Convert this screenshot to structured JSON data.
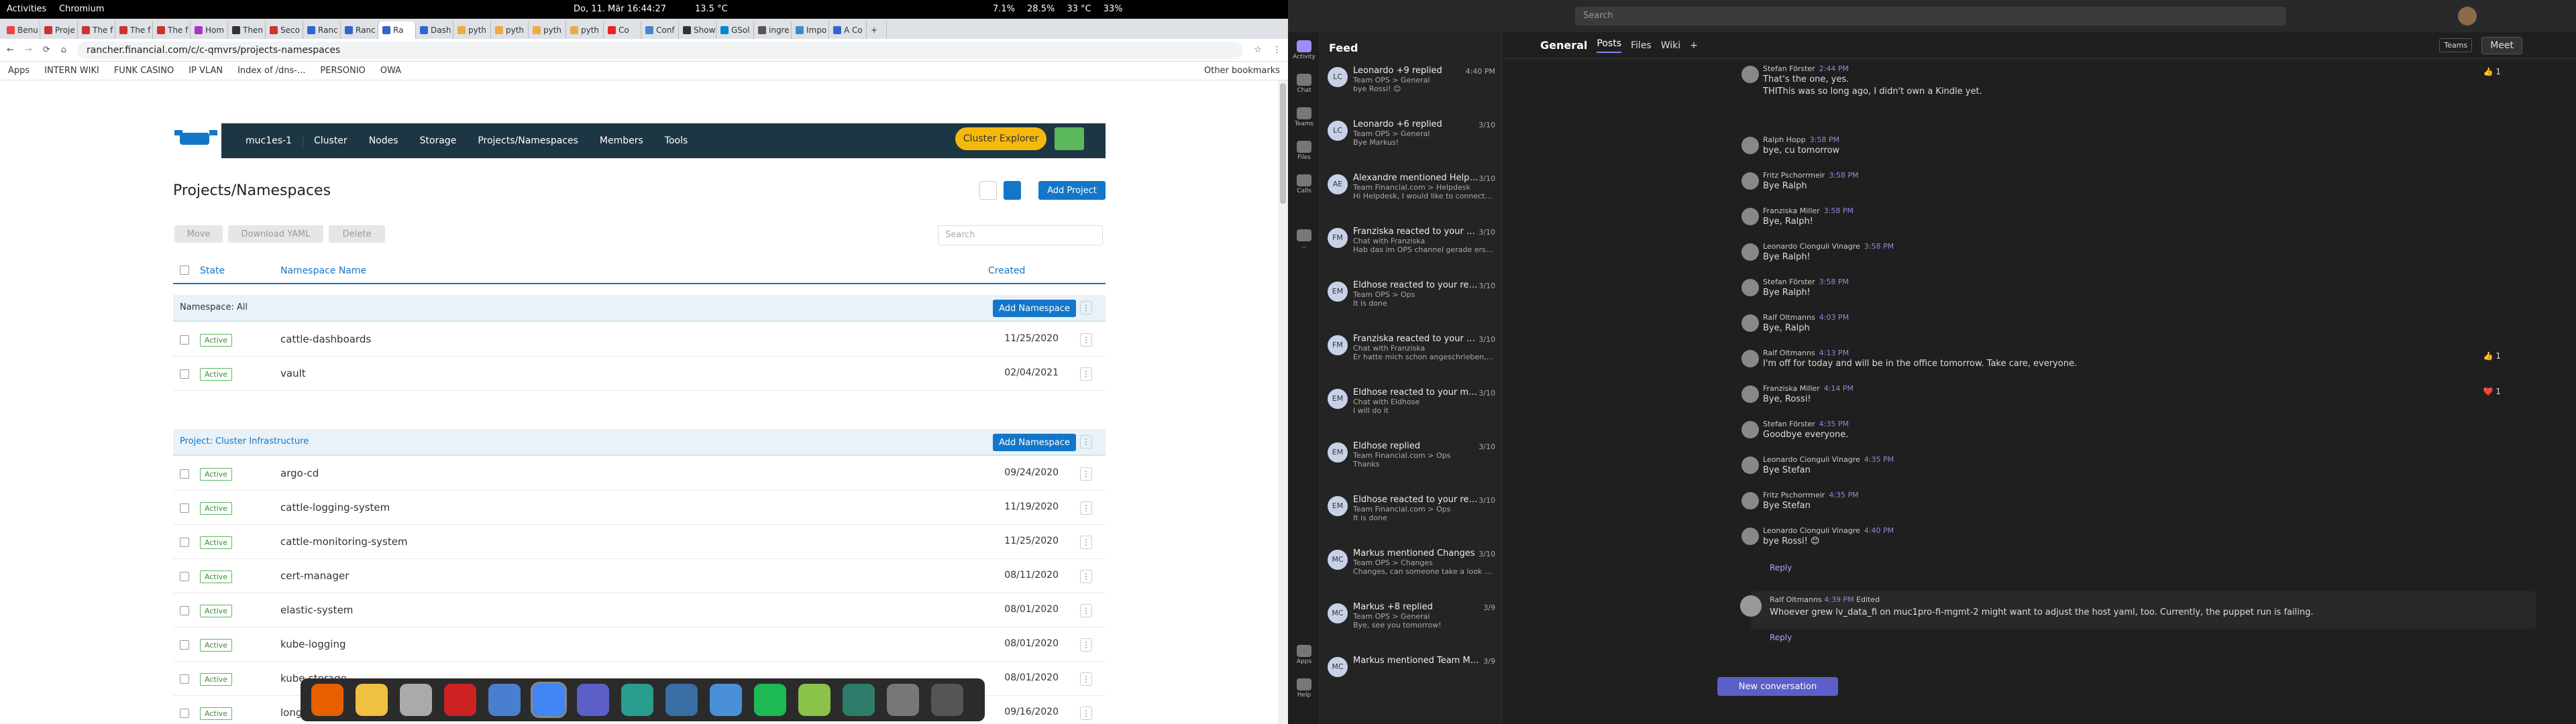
{
  "topbar": {
    "activities": "Activities",
    "app": "Chromium",
    "clock": "Do, 11. Mär 16:44:27",
    "weather": "13.5 °C",
    "cpu": "7.1%",
    "mem": "28.5%",
    "temp": "33 °C",
    "battery": "33%"
  },
  "tabs": [
    "Benu",
    "Proje",
    "The f",
    "The f",
    "The f",
    "Hom",
    "Then",
    "Seco",
    "Ranc",
    "Ranc",
    "Ra",
    "Dash",
    "pyth",
    "pyth",
    "pyth",
    "pyth",
    "Co",
    "Conf",
    "Show",
    "GSol",
    "ingre",
    "Impo",
    "A Co"
  ],
  "address": {
    "url": "rancher.financial.com/c/c-qmvrs/projects-namespaces"
  },
  "bookmarks": [
    "Apps",
    "INTERN WIKI",
    "FUNK CASINO",
    "IP VLAN",
    "Index of /dns-...",
    "PERSONIO",
    "OWA",
    "Other bookmarks"
  ],
  "rancher": {
    "nav": {
      "cluster_select": "muc1es-1",
      "items": [
        "Cluster",
        "Nodes",
        "Storage",
        "Projects/Namespaces",
        "Members",
        "Tools"
      ],
      "explorer": "Cluster Explorer"
    },
    "title": "Projects/Namespaces",
    "add_project": "Add Project",
    "actions": {
      "move": "Move",
      "download": "Download YAML",
      "delete": "Delete"
    },
    "search_placeholder": "Search",
    "headers": {
      "state": "State",
      "name": "Namespace Name",
      "created": "Created"
    },
    "add_namespace": "Add Namespace",
    "group_all": "Namespace: All",
    "group_infra": "Project: Cluster Infrastructure",
    "rows_all": [
      {
        "state": "Active",
        "name": "cattle-dashboards",
        "created": "11/25/2020"
      },
      {
        "state": "Active",
        "name": "vault",
        "created": "02/04/2021"
      }
    ],
    "rows_infra": [
      {
        "state": "Active",
        "name": "argo-cd",
        "created": "09/24/2020"
      },
      {
        "state": "Active",
        "name": "cattle-logging-system",
        "created": "11/19/2020"
      },
      {
        "state": "Active",
        "name": "cattle-monitoring-system",
        "created": "11/25/2020"
      },
      {
        "state": "Active",
        "name": "cert-manager",
        "created": "08/11/2020"
      },
      {
        "state": "Active",
        "name": "elastic-system",
        "created": "08/01/2020"
      },
      {
        "state": "Active",
        "name": "kube-logging",
        "created": "08/01/2020"
      },
      {
        "state": "Active",
        "name": "kube-storage",
        "created": "08/01/2020"
      },
      {
        "state": "Active",
        "name": "long",
        "created": "09/16/2020"
      }
    ]
  },
  "teams": {
    "search": "Search",
    "feed_title": "Feed",
    "rail": [
      "Activity",
      "Chat",
      "Teams",
      "Files",
      "Calls",
      "...",
      "Apps",
      "Help"
    ],
    "feed": [
      {
        "av": "LC",
        "title": "Leonardo +9 replied",
        "sub1": "Team OPS > General",
        "sub2": "bye Rossi! 😊",
        "time": "4:40 PM"
      },
      {
        "av": "LC",
        "title": "Leonardo +6 replied",
        "sub1": "Team OPS > General",
        "sub2": "Bye Markus!",
        "time": "3/10"
      },
      {
        "av": "AE",
        "title": "Alexandre mentioned Helpdesk",
        "sub1": "Team Financial.com > Helpdesk",
        "sub2": "Hi Helpdesk, I would like to connect the call syste...",
        "time": "3/10"
      },
      {
        "av": "FM",
        "title": "Franziska reacted to your message",
        "sub1": "Chat with Franziska",
        "sub2": "Hab das im OPS channel gerade erst gesehen, hab...",
        "time": "3/10"
      },
      {
        "av": "EM",
        "title": "Eldhose reacted to your reply",
        "sub1": "Team OPS > Ops",
        "sub2": "It is done",
        "time": "3/10"
      },
      {
        "av": "FM",
        "title": "Franziska reacted to your message",
        "sub1": "Chat with Franziska",
        "sub2": "Er hatte mich schon angeschrieben, ob ich das...",
        "time": "3/10"
      },
      {
        "av": "EM",
        "title": "Eldhose reacted to your message",
        "sub1": "Chat with Eldhose",
        "sub2": "I will do it",
        "time": "3/10"
      },
      {
        "av": "EM",
        "title": "Eldhose replied",
        "sub1": "Team Financial.com > Ops",
        "sub2": "Thanks",
        "time": "3/10"
      },
      {
        "av": "EM",
        "title": "Eldhose reacted to your reply",
        "sub1": "Team Financial.com > Ops",
        "sub2": "It is done",
        "time": "3/10"
      },
      {
        "av": "MC",
        "title": "Markus mentioned Changes",
        "sub1": "Team OPS > Changes",
        "sub2": "Changes, can someone take a look please? I had t...",
        "time": "3/10"
      },
      {
        "av": "MC",
        "title": "Markus +8 replied",
        "sub1": "Team OPS > General",
        "sub2": "Bye, see you tomorrow!",
        "time": "3/9"
      },
      {
        "av": "MC",
        "title": "Markus mentioned Team MUC",
        "sub1": "",
        "sub2": "",
        "time": "3/9"
      }
    ],
    "channel": "General",
    "tabs": [
      "Posts",
      "Files",
      "Wiki"
    ],
    "team_btn": "Teams",
    "meet": "Meet",
    "messages": [
      {
        "who": "Stefan Förster",
        "time": "2:44 PM",
        "text": "That's the one, yes.",
        "react": "👍 1"
      },
      {
        "who": "",
        "time": "",
        "text": "THIThis was so long ago, I didn't own a Kindle yet.",
        "react": ""
      },
      {
        "who": "Ralph Hopp",
        "time": "3:58 PM",
        "text": "bye, cu tomorrow",
        "react": ""
      },
      {
        "who": "Fritz Pschorrmeir",
        "time": "3:58 PM",
        "text": "Bye Ralph",
        "react": ""
      },
      {
        "who": "Franziska Miller",
        "time": "3:58 PM",
        "text": "Bye, Ralph!",
        "react": ""
      },
      {
        "who": "Leonardo Cionguli Vinagre",
        "time": "3:58 PM",
        "text": "Bye Ralph!",
        "react": ""
      },
      {
        "who": "Stefan Förster",
        "time": "3:58 PM",
        "text": "Bye Ralph!",
        "react": ""
      },
      {
        "who": "Ralf Oltmanns",
        "time": "4:03 PM",
        "text": "Bye, Ralph",
        "react": ""
      },
      {
        "who": "Ralf Oltmanns",
        "time": "4:13 PM",
        "text": "I'm off for today and will be in the office tomorrow. Take care, everyone.",
        "react": "👍 1"
      },
      {
        "who": "Franziska Miller",
        "time": "4:14 PM",
        "text": "Bye, Rossi!",
        "react": "❤️ 1"
      },
      {
        "who": "Stefan Förster",
        "time": "4:35 PM",
        "text": "Goodbye everyone.",
        "react": ""
      },
      {
        "who": "Leonardo Cionguli Vinagre",
        "time": "4:35 PM",
        "text": "Bye Stefan",
        "react": ""
      },
      {
        "who": "Fritz Pschorrmeir",
        "time": "4:35 PM",
        "text": "Bye Stefan",
        "react": ""
      },
      {
        "who": "Leonardo Cionguli Vinagre",
        "time": "4:40 PM",
        "text": "bye Rossi! 😊",
        "react": ""
      }
    ],
    "reply": "Reply",
    "last_post": {
      "who": "Ralf Oltmanns",
      "time": "4:39 PM",
      "edited": "Edited",
      "text": "Whoever grew lv_data_fi on muc1pro-fi-mgmt-2 might want to adjust the host yaml, too. Currently, the puppet run is failing."
    },
    "new_conversation": "New conversation"
  }
}
